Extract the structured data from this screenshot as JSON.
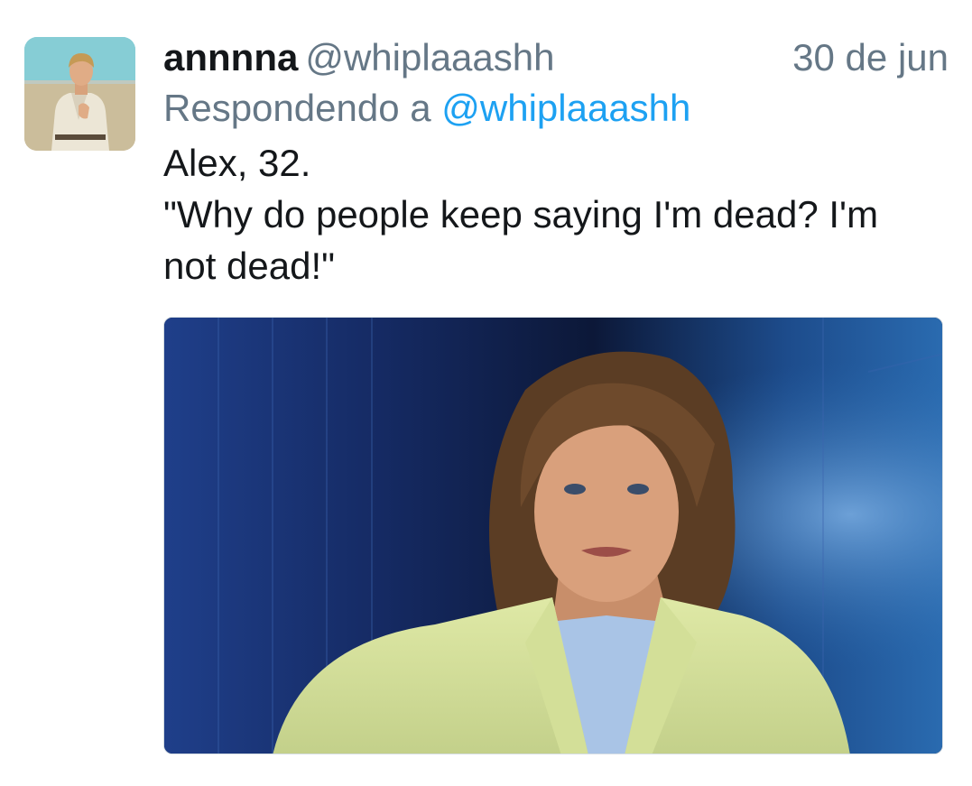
{
  "tweet": {
    "display_name": "annnna",
    "handle": "@whiplaaashh",
    "timestamp": "30 de jun",
    "reply_prefix": "Respondendo a",
    "reply_to": "@whiplaaashh",
    "text_line1": "Alex, 32.",
    "text_line2": "\"Why do people keep saying I'm dead? I'm not dead!\""
  },
  "colors": {
    "name": "#14171a",
    "secondary": "#657786",
    "link": "#1da1f2"
  },
  "icons": {
    "avatar": "profile-photo",
    "media": "attached-photo"
  }
}
